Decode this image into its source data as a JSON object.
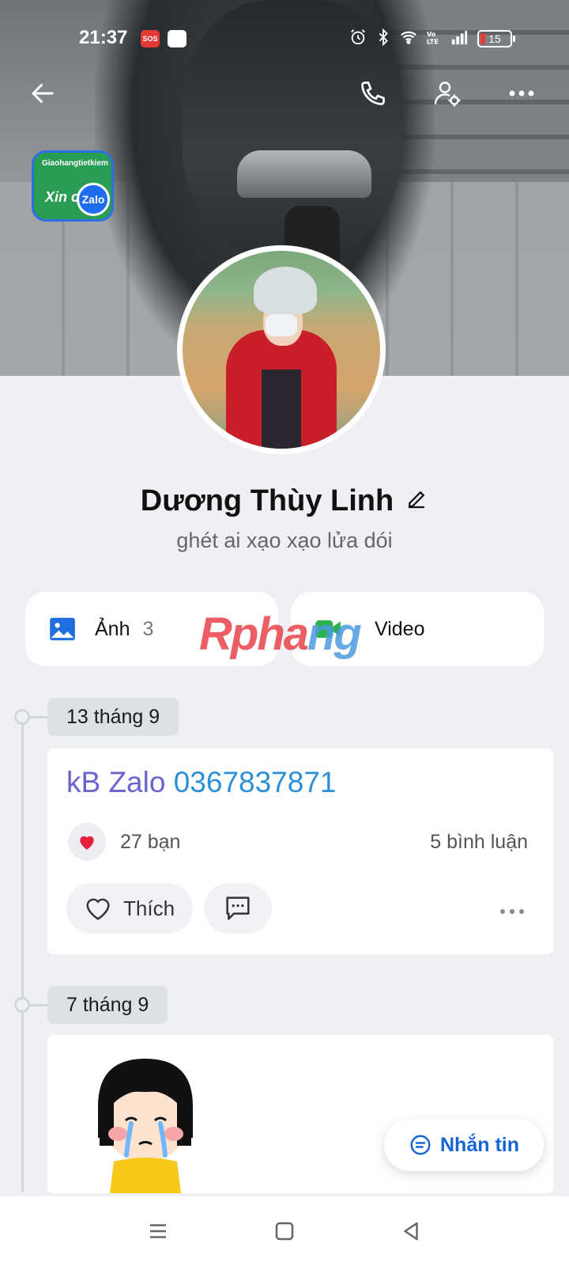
{
  "status_bar": {
    "time": "21:37",
    "sos": "SOS",
    "battery": "15",
    "icons": [
      "alarm-icon",
      "bluetooth-icon",
      "wifi-icon",
      "volte-icon",
      "signal-icon"
    ]
  },
  "header": {
    "icons": [
      "back-arrow-icon",
      "phone-icon",
      "user-settings-icon",
      "more-icon"
    ]
  },
  "cover_badge": {
    "line1": "Giaohangtietkiem",
    "line2": "Xin chào",
    "logo": "Zalo"
  },
  "profile": {
    "name": "Dương Thùy Linh",
    "status": "ghét ai xạo xạo lửa dói"
  },
  "media": {
    "photos_label": "Ảnh",
    "photos_count": "3",
    "videos_label": "Video"
  },
  "watermark": {
    "part1": "Rpha",
    "part2": "ng"
  },
  "timeline": [
    {
      "date": "13 tháng 9",
      "text_prefix": "kB Zalo ",
      "text_number": "0367837871",
      "reactions": "27 bạn",
      "comments": "5 bình luận",
      "like_label": "Thích"
    },
    {
      "date": "7 tháng 9"
    }
  ],
  "chat_button": "Nhắn tin",
  "colors": {
    "accent": "#1565d8",
    "post_text": "#6a63cf",
    "phone_link": "#2b8fd8",
    "heart": "#e41e3f"
  }
}
